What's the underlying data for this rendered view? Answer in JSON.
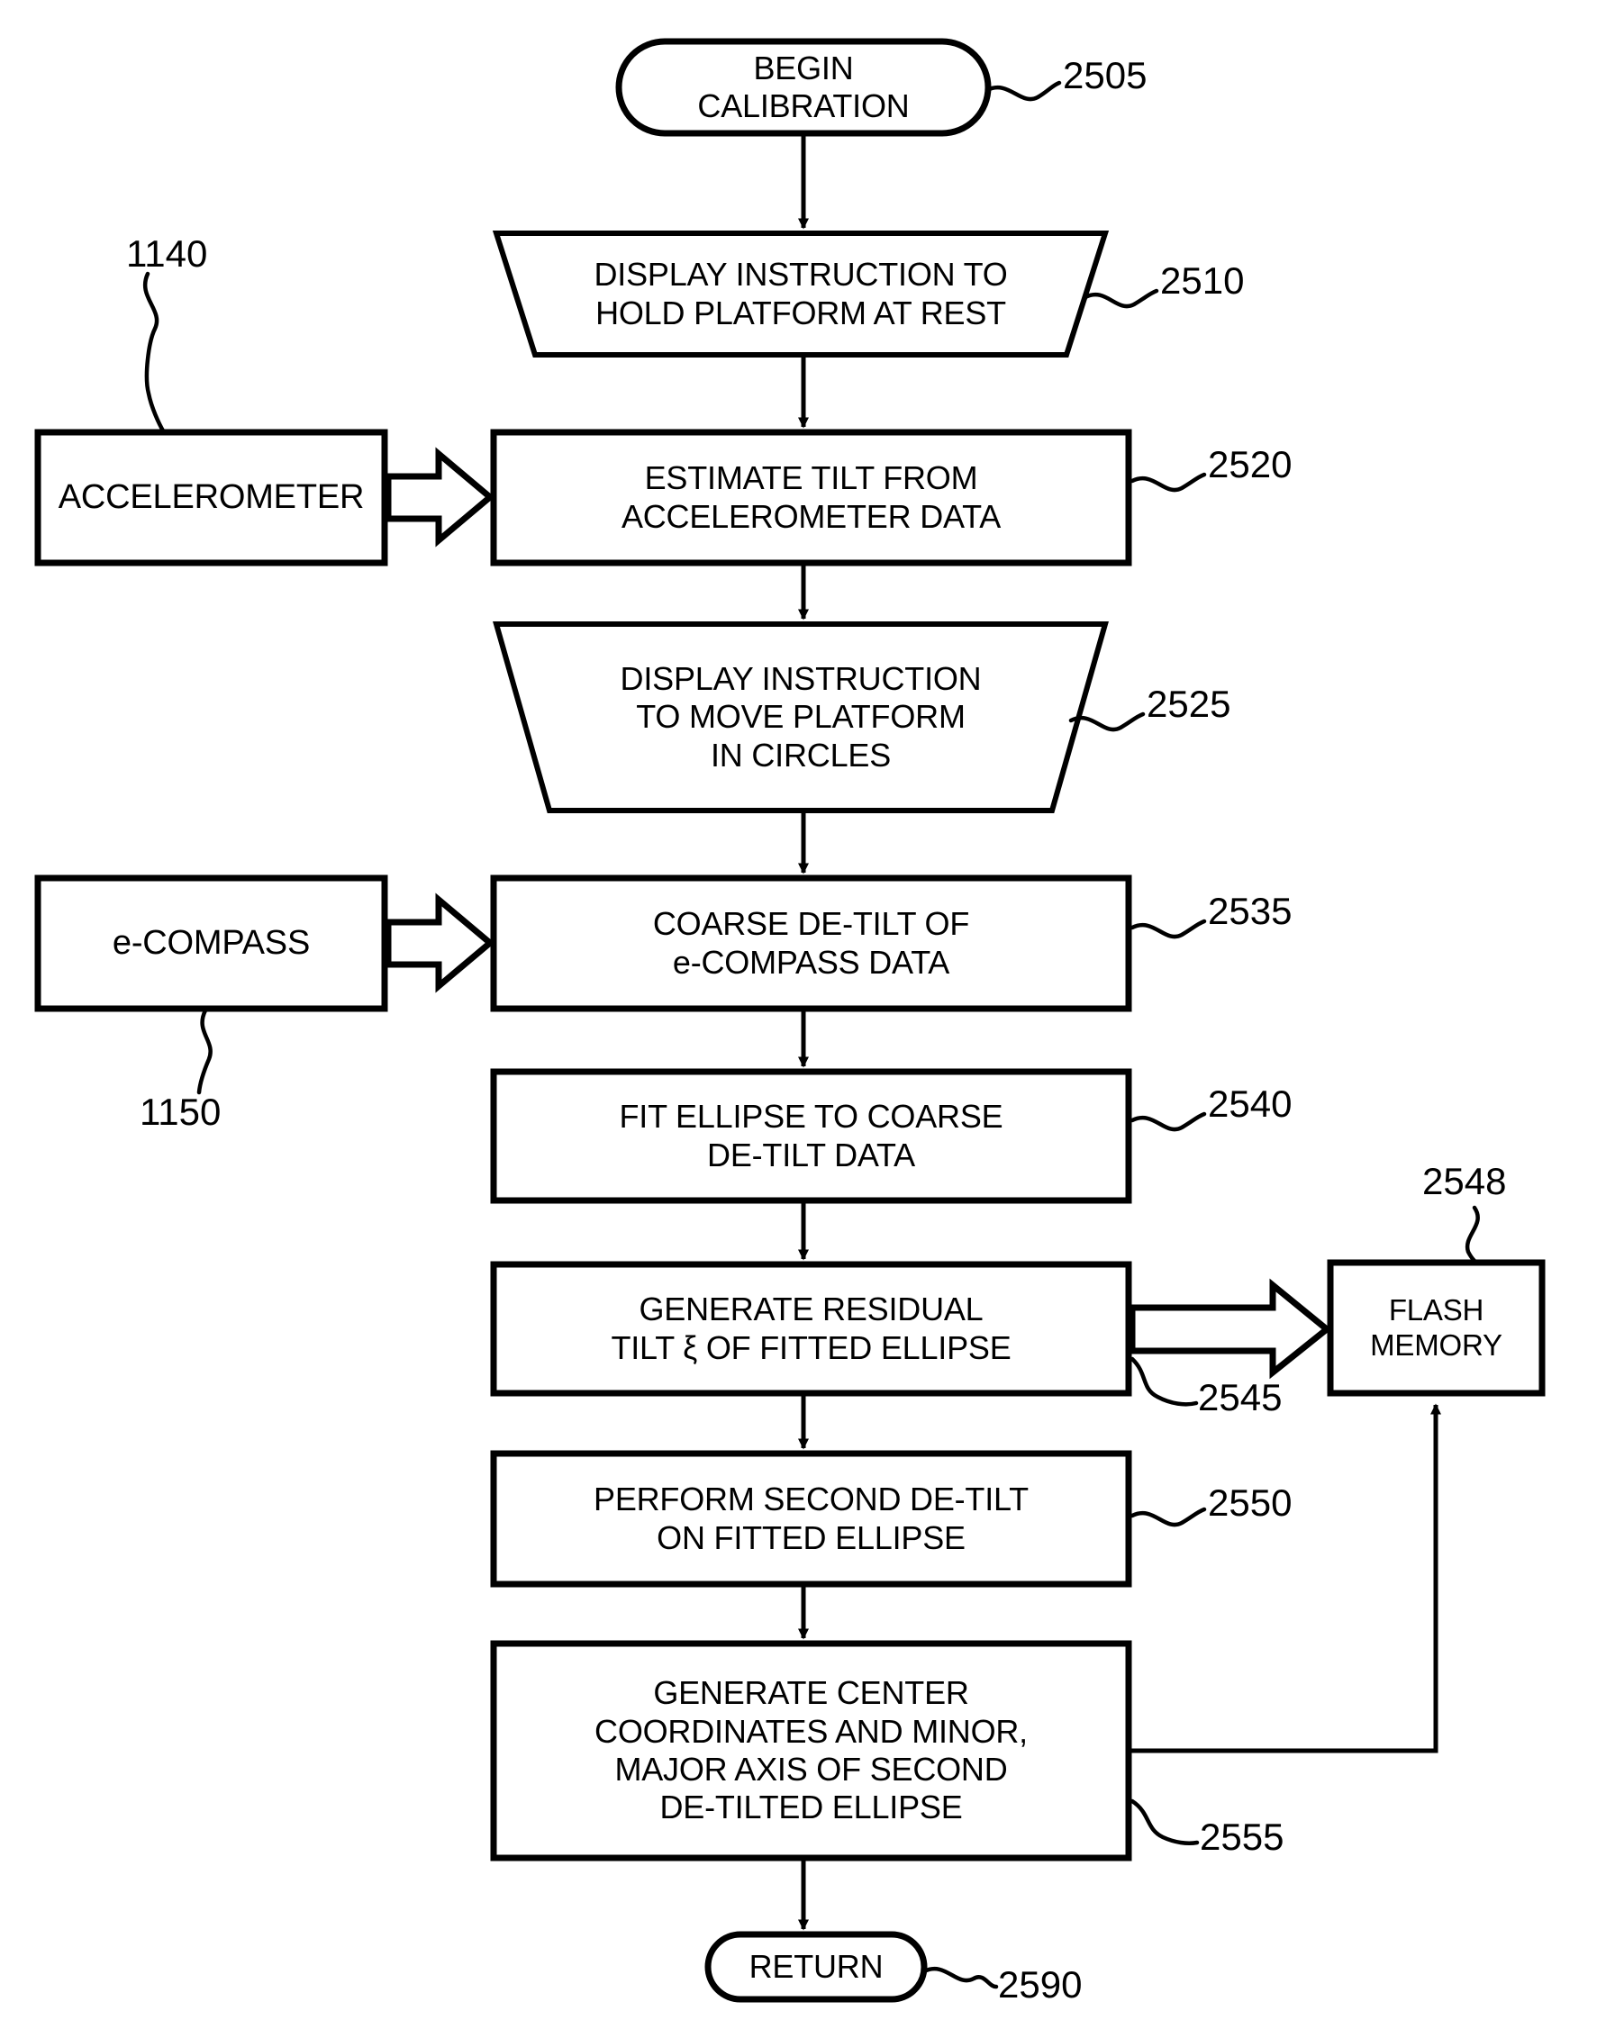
{
  "figure": {
    "type": "patent-flowchart",
    "title": "Calibration process flowchart"
  },
  "nodes": {
    "begin": {
      "shape": "terminator",
      "ref": "2505",
      "lines": [
        "BEGIN",
        "CALIBRATION"
      ]
    },
    "display_hold": {
      "shape": "trapezoid-io",
      "ref": "2510",
      "lines": [
        "DISPLAY INSTRUCTION TO",
        "HOLD PLATFORM AT REST"
      ]
    },
    "accelerometer": {
      "shape": "rect-external",
      "ref": "1140",
      "lines": [
        "ACCELEROMETER"
      ]
    },
    "estimate_tilt": {
      "shape": "rect-process",
      "ref": "2520",
      "lines": [
        "ESTIMATE TILT FROM",
        "ACCELEROMETER DATA"
      ]
    },
    "display_circles": {
      "shape": "trapezoid-io",
      "ref": "2525",
      "lines": [
        "DISPLAY INSTRUCTION",
        "TO MOVE PLATFORM",
        "IN CIRCLES"
      ]
    },
    "ecompass": {
      "shape": "rect-external",
      "ref": "1150",
      "lines": [
        "e-COMPASS"
      ]
    },
    "coarse_detilt": {
      "shape": "rect-process",
      "ref": "2535",
      "lines": [
        "COARSE DE-TILT OF",
        "e-COMPASS DATA"
      ]
    },
    "fit_ellipse": {
      "shape": "rect-process",
      "ref": "2540",
      "lines": [
        "FIT ELLIPSE TO COARSE",
        "DE-TILT DATA"
      ]
    },
    "residual_tilt": {
      "shape": "rect-process",
      "ref": "2545",
      "lines": [
        "GENERATE RESIDUAL",
        "TILT ξ OF FITTED ELLIPSE"
      ]
    },
    "flash_memory": {
      "shape": "rect-external",
      "ref": "2548",
      "lines": [
        "FLASH",
        "MEMORY"
      ]
    },
    "second_detilt": {
      "shape": "rect-process",
      "ref": "2550",
      "lines": [
        "PERFORM SECOND DE-TILT",
        "ON FITTED ELLIPSE"
      ]
    },
    "generate_center": {
      "shape": "rect-process",
      "ref": "2555",
      "lines": [
        "GENERATE CENTER",
        "COORDINATES AND MINOR,",
        "MAJOR AXIS OF SECOND",
        "DE-TILTED ELLIPSE"
      ]
    },
    "return": {
      "shape": "terminator",
      "ref": "2590",
      "lines": [
        "RETURN"
      ]
    }
  },
  "refs": {
    "r2505": "2505",
    "r2510": "2510",
    "r1140": "1140",
    "r2520": "2520",
    "r2525": "2525",
    "r1150": "1150",
    "r2535": "2535",
    "r2540": "2540",
    "r2545": "2545",
    "r2548": "2548",
    "r2550": "2550",
    "r2555": "2555",
    "r2590": "2590"
  },
  "style": {
    "stroke": "#000000",
    "fill": "#ffffff",
    "background": "#ffffff"
  }
}
